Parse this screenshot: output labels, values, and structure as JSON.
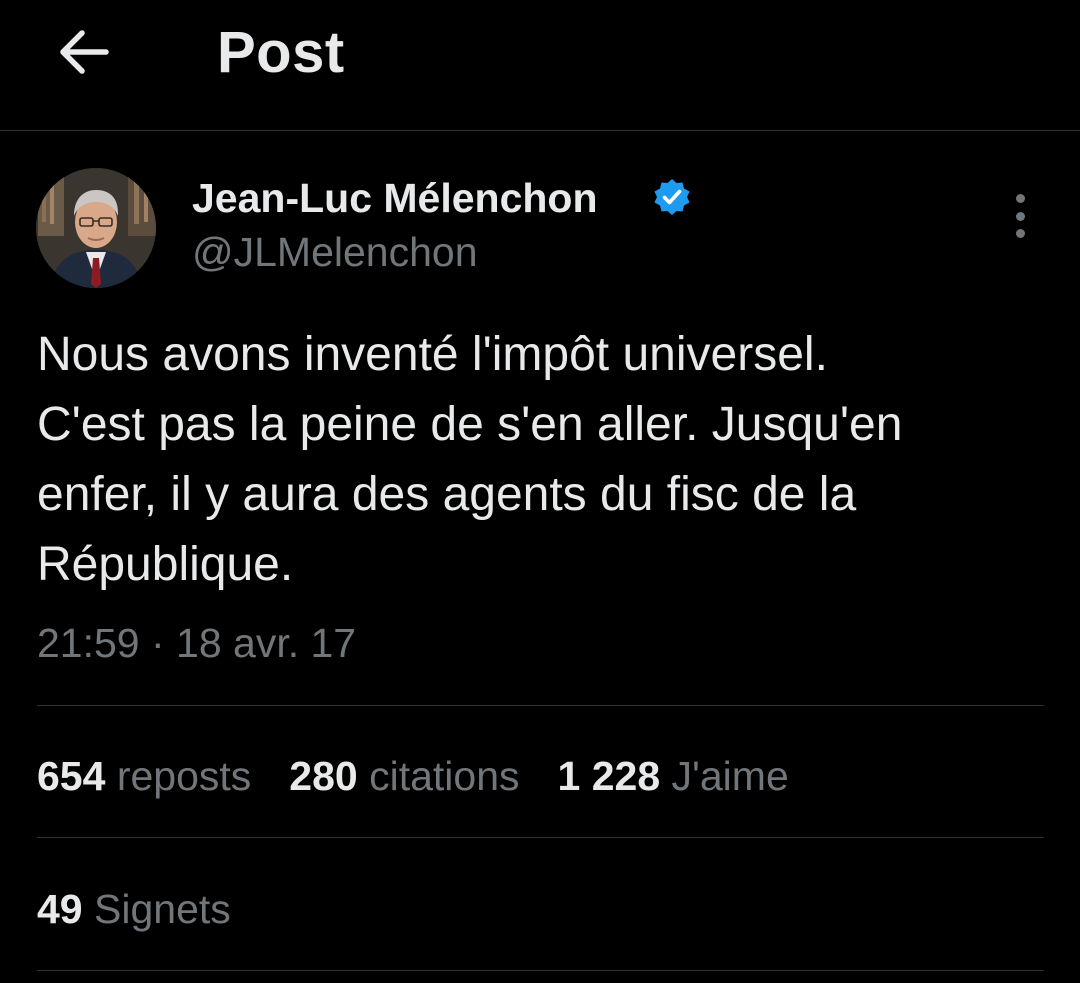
{
  "header": {
    "title": "Post",
    "back_icon": "arrow-left-icon"
  },
  "author": {
    "name": "Jean-Luc Mélenchon",
    "handle": "@JLMelenchon",
    "verified": true,
    "verified_color": "#1d9bf0",
    "avatar": "profile-photo"
  },
  "post": {
    "text": "Nous avons inventé l'impôt universel.\nC'est pas la peine de s'en aller. Jusqu'en\nenfer, il y aura des agents du fisc de la\nRépublique.",
    "timestamp": "21:59 · 18 avr. 17"
  },
  "stats": {
    "reposts_count": "654",
    "reposts_label": "reposts",
    "quotes_count": "280",
    "quotes_label": "citations",
    "likes_count": "1 228",
    "likes_label": "J'aime",
    "bookmarks_count": "49",
    "bookmarks_label": "Signets"
  },
  "colors": {
    "background": "#000000",
    "primary_text": "#e7e9ea",
    "secondary_text": "#71767b",
    "divider": "#2f3336"
  }
}
